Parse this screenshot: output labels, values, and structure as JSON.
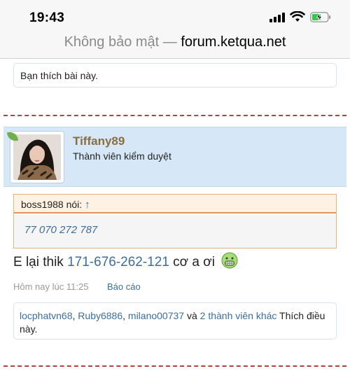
{
  "status_bar": {
    "time": "19:43",
    "icons": [
      "signal-icon",
      "wifi-icon",
      "battery-charging-icon"
    ]
  },
  "browser": {
    "security_label": "Không bảo mật —",
    "domain": "forum.ketqua.net"
  },
  "previous_post": {
    "like_text": "Bạn thích bài này."
  },
  "post": {
    "username": "Tiffany89",
    "user_title": "Thành viên kiểm duyệt",
    "quote": {
      "author_label": "boss1988 nói:",
      "arrow": "↑",
      "text": "77 070 272 787"
    },
    "message": {
      "before": "E lại thik",
      "link": "171-676-262-121",
      "after": "cơ a ơi"
    },
    "timestamp": "Hôm nay lúc 11:25",
    "report_label": "Báo cáo",
    "likes": {
      "user1": "locphatvn68",
      "sep1": ",",
      "user2": "Ruby6886",
      "sep2": ",",
      "user3": "milano00737",
      "and": "và",
      "others": "2 thành viên khác",
      "suffix": "Thích điều này."
    }
  },
  "colors": {
    "link": "#3d6e99",
    "username": "#8a6d3b",
    "separator": "#b24040",
    "user_panel": "#d6e8f8"
  }
}
